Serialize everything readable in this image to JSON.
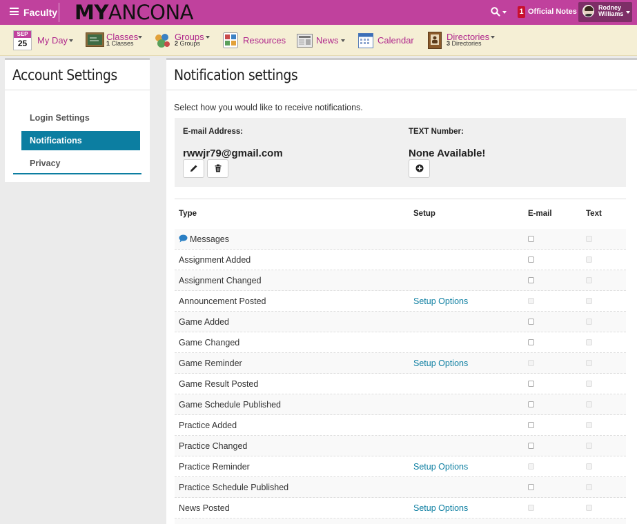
{
  "topbar": {
    "role": "Faculty",
    "logo_bold": "MY",
    "logo_rest": "ANCONA",
    "notes_count": "1",
    "notes_label": "Official Notes",
    "user_first": "Rodney",
    "user_last": "Williams",
    "accent": "#c0419d"
  },
  "nav": {
    "calendar_month": "SEP",
    "calendar_day": "25",
    "myday": "My Day",
    "classes": "Classes",
    "classes_count": "1",
    "classes_unit": "Classes",
    "groups": "Groups",
    "groups_count": "2",
    "groups_unit": "Groups",
    "resources": "Resources",
    "news": "News",
    "calendar": "Calendar",
    "directories": "Directories",
    "directories_count": "3",
    "directories_unit": "Directories"
  },
  "sidebar": {
    "title": "Account Settings",
    "items": [
      {
        "label": "Login Settings",
        "active": false
      },
      {
        "label": "Notifications",
        "active": true
      },
      {
        "label": "Privacy",
        "active": false
      }
    ]
  },
  "main": {
    "title": "Notification settings",
    "instructions": "Select how you would like to receive notifications.",
    "email_label": "E-mail Address:",
    "email_value": "rwwjr79@gmail.com",
    "text_label": "TEXT Number:",
    "text_value": "None Available!"
  },
  "table": {
    "headers": {
      "type": "Type",
      "setup": "Setup",
      "email": "E-mail",
      "text": "Text"
    },
    "rows": [
      {
        "type": "Messages",
        "setup": "",
        "email_enabled": true,
        "text_enabled": false,
        "icon": "speech-bubble-icon"
      },
      {
        "type": "Assignment Added",
        "setup": "",
        "email_enabled": true,
        "text_enabled": false
      },
      {
        "type": "Assignment Changed",
        "setup": "",
        "email_enabled": true,
        "text_enabled": false
      },
      {
        "type": "Announcement Posted",
        "setup": "Setup Options",
        "email_enabled": false,
        "text_enabled": false
      },
      {
        "type": "Game Added",
        "setup": "",
        "email_enabled": true,
        "text_enabled": false
      },
      {
        "type": "Game Changed",
        "setup": "",
        "email_enabled": true,
        "text_enabled": false
      },
      {
        "type": "Game Reminder",
        "setup": "Setup Options",
        "email_enabled": false,
        "text_enabled": false
      },
      {
        "type": "Game Result Posted",
        "setup": "",
        "email_enabled": true,
        "text_enabled": false
      },
      {
        "type": "Game Schedule Published",
        "setup": "",
        "email_enabled": true,
        "text_enabled": false
      },
      {
        "type": "Practice Added",
        "setup": "",
        "email_enabled": true,
        "text_enabled": false
      },
      {
        "type": "Practice Changed",
        "setup": "",
        "email_enabled": true,
        "text_enabled": false
      },
      {
        "type": "Practice Reminder",
        "setup": "Setup Options",
        "email_enabled": false,
        "text_enabled": false
      },
      {
        "type": "Practice Schedule Published",
        "setup": "",
        "email_enabled": true,
        "text_enabled": false
      },
      {
        "type": "News Posted",
        "setup": "Setup Options",
        "email_enabled": false,
        "text_enabled": false
      },
      {
        "type": "",
        "setup": "",
        "email_enabled": false,
        "text_enabled": false
      }
    ]
  }
}
